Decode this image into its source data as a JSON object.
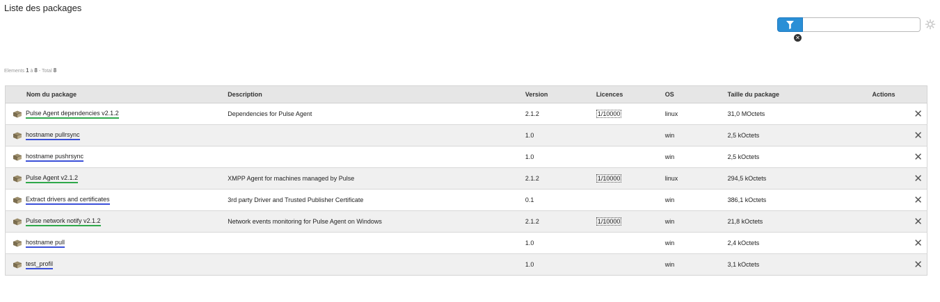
{
  "page": {
    "title": "Liste des packages"
  },
  "filter": {
    "value": "",
    "placeholder": ""
  },
  "pager": {
    "prefix": "Elements",
    "from": "1",
    "sep": "à",
    "to": "8",
    "total_label": "- Total",
    "total": "8"
  },
  "table": {
    "headers": {
      "name": "Nom du package",
      "description": "Description",
      "version": "Version",
      "licences": "Licences",
      "os": "OS",
      "size": "Taille du package",
      "actions": "Actions"
    },
    "rows": [
      {
        "name": "Pulse Agent dependencies v2.1.2",
        "link_color": "green",
        "description": "Dependencies for Pulse Agent",
        "version": "2.1.2",
        "licences": "1/10000",
        "os": "linux",
        "size": "31,0 MOctets"
      },
      {
        "name": "hostname pullrsync",
        "link_color": "blue",
        "description": "",
        "version": "1.0",
        "licences": "",
        "os": "win",
        "size": "2,5 kOctets"
      },
      {
        "name": "hostname pushrsync",
        "link_color": "blue",
        "description": "",
        "version": "1.0",
        "licences": "",
        "os": "win",
        "size": "2,5 kOctets"
      },
      {
        "name": "Pulse Agent v2.1.2",
        "link_color": "green",
        "description": "XMPP Agent for machines managed by Pulse",
        "version": "2.1.2",
        "licences": "1/10000",
        "os": "linux",
        "size": "294,5 kOctets"
      },
      {
        "name": "Extract drivers and certificates",
        "link_color": "blue",
        "description": "3rd party Driver and Trusted Publisher Certificate",
        "version": "0.1",
        "licences": "",
        "os": "win",
        "size": "386,1 kOctets"
      },
      {
        "name": "Pulse network notify v2.1.2",
        "link_color": "green",
        "description": "Network events monitoring for Pulse Agent on Windows",
        "version": "2.1.2",
        "licences": "1/10000",
        "os": "win",
        "size": "21,8 kOctets"
      },
      {
        "name": "hostname pull",
        "link_color": "blue",
        "description": "",
        "version": "1.0",
        "licences": "",
        "os": "win",
        "size": "2,4 kOctets"
      },
      {
        "name": "test_profil",
        "link_color": "blue",
        "description": "",
        "version": "1.0",
        "licences": "",
        "os": "win",
        "size": "3,1 kOctets"
      }
    ]
  },
  "icons": {
    "filter": "filter-funnel-icon",
    "clear": "clear-circle-x-icon",
    "settings": "gear-icon",
    "package": "package-box-icon",
    "delete": "delete-x-icon"
  },
  "colors": {
    "accent": "#2a8fd6",
    "link_green": "#2ea84a",
    "link_blue": "#3a4fd8",
    "header_bg": "#e6e6e6",
    "row_alt": "#f0f0f0"
  }
}
